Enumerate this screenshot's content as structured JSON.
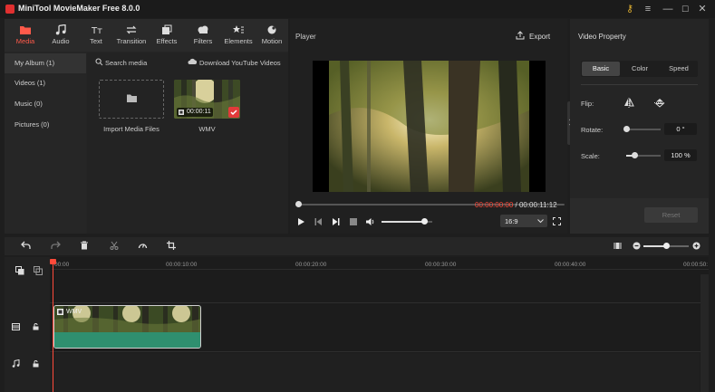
{
  "app": {
    "title": "MiniTool MovieMaker Free 8.0.0"
  },
  "toolbar": {
    "tabs": [
      {
        "label": "Media",
        "icon": "folder-icon",
        "active": true
      },
      {
        "label": "Audio",
        "icon": "music-note-icon",
        "active": false
      },
      {
        "label": "Text",
        "icon": "text-icon",
        "active": false
      },
      {
        "label": "Transition",
        "icon": "transition-arrows-icon",
        "active": false
      },
      {
        "label": "Effects",
        "icon": "effects-icon",
        "active": false
      },
      {
        "label": "Filters",
        "icon": "filters-cloud-icon",
        "active": false
      },
      {
        "label": "Elements",
        "icon": "elements-star-icon",
        "active": false
      },
      {
        "label": "Motion",
        "icon": "motion-icon",
        "active": false
      }
    ]
  },
  "albums": [
    {
      "label": "My Album (1)",
      "selected": true
    },
    {
      "label": "Videos (1)",
      "selected": false
    },
    {
      "label": "Music (0)",
      "selected": false
    },
    {
      "label": "Pictures (0)",
      "selected": false
    }
  ],
  "media": {
    "search_label": "Search media",
    "download_label": "Download YouTube Videos",
    "import_label": "Import Media Files",
    "clip": {
      "name": "WMV",
      "duration": "00:00:11"
    }
  },
  "player": {
    "title": "Player",
    "export_label": "Export",
    "current_time": "00:00:00:00",
    "separator": " / ",
    "total_time": "00:00:11:12",
    "aspect_ratio": "16:9",
    "progress": 0,
    "volume": 0.85
  },
  "properties": {
    "title": "Video Property",
    "tabs": [
      "Basic",
      "Color",
      "Speed"
    ],
    "active_tab": "Basic",
    "flip_label": "Flip:",
    "rotate_label": "Rotate:",
    "rotate_value": "0 °",
    "scale_label": "Scale:",
    "scale_value": "100 %",
    "reset_label": "Reset"
  },
  "timeline": {
    "ticks": [
      "00:00",
      "00:00:10:00",
      "00:00:20:00",
      "00:00:30:00",
      "00:00:40:00",
      "00:00:50:"
    ],
    "clip_label": "WMV",
    "zoom": 0.5
  },
  "colors": {
    "accent": "#ff4a3a",
    "clip_audio": "#2f8f6f",
    "panel": "#252525"
  }
}
